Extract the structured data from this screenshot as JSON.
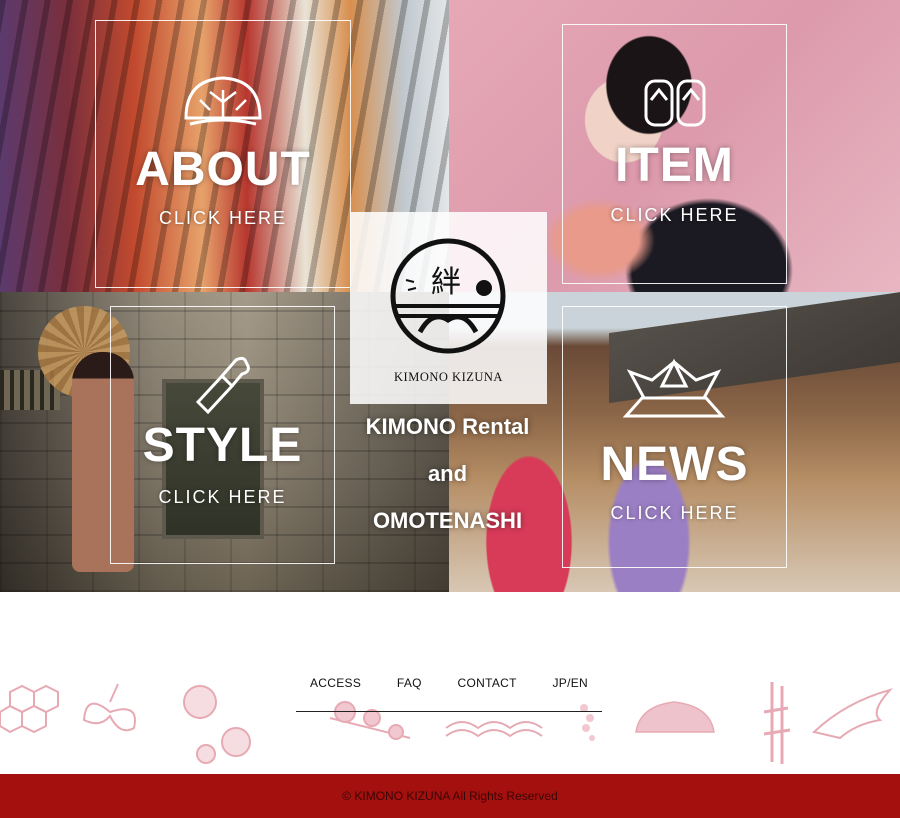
{
  "brand": {
    "logo_kanji": "絆",
    "logo_name": "KIMONO KIZUNA",
    "tagline": [
      "KIMONO Rental",
      "and",
      "OMOTENASHI"
    ]
  },
  "tiles": [
    {
      "title": "ABOUT",
      "link": "CLICK HERE",
      "icon": "pine-tree-icon"
    },
    {
      "title": "ITEM",
      "link": "CLICK HERE",
      "icon": "geta-sandals-icon"
    },
    {
      "title": "STYLE",
      "link": "CLICK HERE",
      "icon": "makeup-brush-icon"
    },
    {
      "title": "NEWS",
      "link": "CLICK HERE",
      "icon": "kabuto-helmet-icon"
    }
  ],
  "nav": [
    "ACCESS",
    "FAQ",
    "CONTACT",
    "JP/EN"
  ],
  "footer": {
    "copyright": "© KIMONO KIZUNA All Rights Reserved"
  },
  "colors": {
    "footer_bar": "#a3100e",
    "motif_pink": "#e7aab4"
  }
}
